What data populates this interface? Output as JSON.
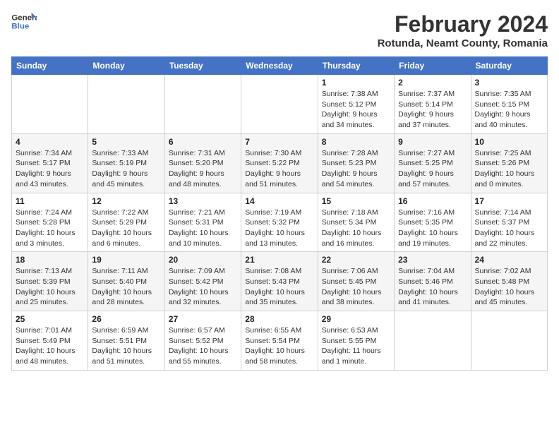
{
  "header": {
    "logo_line1": "General",
    "logo_line2": "Blue",
    "month_title": "February 2024",
    "subtitle": "Rotunda, Neamt County, Romania"
  },
  "weekdays": [
    "Sunday",
    "Monday",
    "Tuesday",
    "Wednesday",
    "Thursday",
    "Friday",
    "Saturday"
  ],
  "weeks": [
    [
      {
        "day": "",
        "info": ""
      },
      {
        "day": "",
        "info": ""
      },
      {
        "day": "",
        "info": ""
      },
      {
        "day": "",
        "info": ""
      },
      {
        "day": "1",
        "info": "Sunrise: 7:38 AM\nSunset: 5:12 PM\nDaylight: 9 hours\nand 34 minutes."
      },
      {
        "day": "2",
        "info": "Sunrise: 7:37 AM\nSunset: 5:14 PM\nDaylight: 9 hours\nand 37 minutes."
      },
      {
        "day": "3",
        "info": "Sunrise: 7:35 AM\nSunset: 5:15 PM\nDaylight: 9 hours\nand 40 minutes."
      }
    ],
    [
      {
        "day": "4",
        "info": "Sunrise: 7:34 AM\nSunset: 5:17 PM\nDaylight: 9 hours\nand 43 minutes."
      },
      {
        "day": "5",
        "info": "Sunrise: 7:33 AM\nSunset: 5:19 PM\nDaylight: 9 hours\nand 45 minutes."
      },
      {
        "day": "6",
        "info": "Sunrise: 7:31 AM\nSunset: 5:20 PM\nDaylight: 9 hours\nand 48 minutes."
      },
      {
        "day": "7",
        "info": "Sunrise: 7:30 AM\nSunset: 5:22 PM\nDaylight: 9 hours\nand 51 minutes."
      },
      {
        "day": "8",
        "info": "Sunrise: 7:28 AM\nSunset: 5:23 PM\nDaylight: 9 hours\nand 54 minutes."
      },
      {
        "day": "9",
        "info": "Sunrise: 7:27 AM\nSunset: 5:25 PM\nDaylight: 9 hours\nand 57 minutes."
      },
      {
        "day": "10",
        "info": "Sunrise: 7:25 AM\nSunset: 5:26 PM\nDaylight: 10 hours\nand 0 minutes."
      }
    ],
    [
      {
        "day": "11",
        "info": "Sunrise: 7:24 AM\nSunset: 5:28 PM\nDaylight: 10 hours\nand 3 minutes."
      },
      {
        "day": "12",
        "info": "Sunrise: 7:22 AM\nSunset: 5:29 PM\nDaylight: 10 hours\nand 6 minutes."
      },
      {
        "day": "13",
        "info": "Sunrise: 7:21 AM\nSunset: 5:31 PM\nDaylight: 10 hours\nand 10 minutes."
      },
      {
        "day": "14",
        "info": "Sunrise: 7:19 AM\nSunset: 5:32 PM\nDaylight: 10 hours\nand 13 minutes."
      },
      {
        "day": "15",
        "info": "Sunrise: 7:18 AM\nSunset: 5:34 PM\nDaylight: 10 hours\nand 16 minutes."
      },
      {
        "day": "16",
        "info": "Sunrise: 7:16 AM\nSunset: 5:35 PM\nDaylight: 10 hours\nand 19 minutes."
      },
      {
        "day": "17",
        "info": "Sunrise: 7:14 AM\nSunset: 5:37 PM\nDaylight: 10 hours\nand 22 minutes."
      }
    ],
    [
      {
        "day": "18",
        "info": "Sunrise: 7:13 AM\nSunset: 5:39 PM\nDaylight: 10 hours\nand 25 minutes."
      },
      {
        "day": "19",
        "info": "Sunrise: 7:11 AM\nSunset: 5:40 PM\nDaylight: 10 hours\nand 28 minutes."
      },
      {
        "day": "20",
        "info": "Sunrise: 7:09 AM\nSunset: 5:42 PM\nDaylight: 10 hours\nand 32 minutes."
      },
      {
        "day": "21",
        "info": "Sunrise: 7:08 AM\nSunset: 5:43 PM\nDaylight: 10 hours\nand 35 minutes."
      },
      {
        "day": "22",
        "info": "Sunrise: 7:06 AM\nSunset: 5:45 PM\nDaylight: 10 hours\nand 38 minutes."
      },
      {
        "day": "23",
        "info": "Sunrise: 7:04 AM\nSunset: 5:46 PM\nDaylight: 10 hours\nand 41 minutes."
      },
      {
        "day": "24",
        "info": "Sunrise: 7:02 AM\nSunset: 5:48 PM\nDaylight: 10 hours\nand 45 minutes."
      }
    ],
    [
      {
        "day": "25",
        "info": "Sunrise: 7:01 AM\nSunset: 5:49 PM\nDaylight: 10 hours\nand 48 minutes."
      },
      {
        "day": "26",
        "info": "Sunrise: 6:59 AM\nSunset: 5:51 PM\nDaylight: 10 hours\nand 51 minutes."
      },
      {
        "day": "27",
        "info": "Sunrise: 6:57 AM\nSunset: 5:52 PM\nDaylight: 10 hours\nand 55 minutes."
      },
      {
        "day": "28",
        "info": "Sunrise: 6:55 AM\nSunset: 5:54 PM\nDaylight: 10 hours\nand 58 minutes."
      },
      {
        "day": "29",
        "info": "Sunrise: 6:53 AM\nSunset: 5:55 PM\nDaylight: 11 hours\nand 1 minute."
      },
      {
        "day": "",
        "info": ""
      },
      {
        "day": "",
        "info": ""
      }
    ]
  ]
}
